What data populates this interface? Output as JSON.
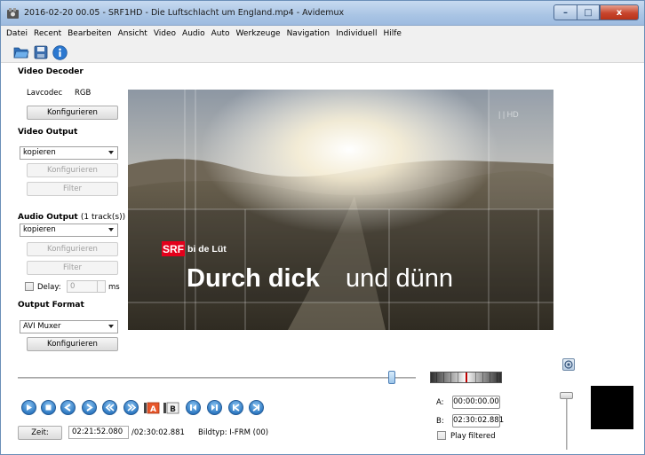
{
  "window": {
    "title": "2016-02-20 00.05 - SRF1HD - Die Luftschlacht um England.mp4 - Avidemux",
    "minimize_label": "–",
    "maximize_label": "□",
    "close_label": "x"
  },
  "menu": [
    "Datei",
    "Recent",
    "Bearbeiten",
    "Ansicht",
    "Video",
    "Audio",
    "Auto",
    "Werkzeuge",
    "Navigation",
    "Individuell",
    "Hilfe"
  ],
  "toolbar": {
    "icons": [
      "open-folder-icon",
      "save-disk-icon",
      "info-icon"
    ]
  },
  "video_decoder": {
    "title": "Video Decoder",
    "codec": "Lavcodec",
    "format": "RGB",
    "configure_label": "Konfigurieren"
  },
  "video_output": {
    "title": "Video Output",
    "selected": "kopieren",
    "configure_label": "Konfigurieren",
    "filter_label": "Filter"
  },
  "audio_output": {
    "title": "Audio Output",
    "tracks": "(1 track(s))",
    "selected": "kopieren",
    "configure_label": "Konfigurieren",
    "filter_label": "Filter",
    "delay_label": "Delay:",
    "delay_value": "0",
    "delay_unit": "ms"
  },
  "output_format": {
    "title": "Output Format",
    "selected": "AVI Muxer",
    "configure_label": "Konfigurieren"
  },
  "video": {
    "logo_text": "SRF",
    "show_prefix": "bi de Lüt",
    "show_title_bold": "Durch dick",
    "show_title_light": "und dünn",
    "corner_mark": "| | HD"
  },
  "seek": {
    "position_fraction": 0.94
  },
  "transport": {
    "buttons": [
      "play-icon",
      "stop-icon",
      "previous-frame-icon",
      "next-frame-icon",
      "rewind-icon",
      "fast-forward-icon",
      "set-marker-a-icon",
      "set-marker-b-icon",
      "previous-black-frame-icon",
      "next-black-frame-icon",
      "goto-start-icon",
      "goto-end-icon"
    ],
    "marker_a": "A",
    "marker_b": "B"
  },
  "status": {
    "zeit_label": "Zeit:",
    "current_time": "02:21:52.080",
    "total_time": "/02:30:02.881",
    "frame_type": "Bildtyp: I-FRM (00)"
  },
  "selection": {
    "a_label": "A:",
    "a_value": "00:00:00.00",
    "b_label": "B:",
    "b_value": "02:30:02.881",
    "play_filtered_label": "Play filtered"
  },
  "colors": {
    "titlebar": "#a9c4e4",
    "accent_blue": "#2f7ac3",
    "close_red": "#c7452d",
    "srf_red": "#e3001b"
  }
}
